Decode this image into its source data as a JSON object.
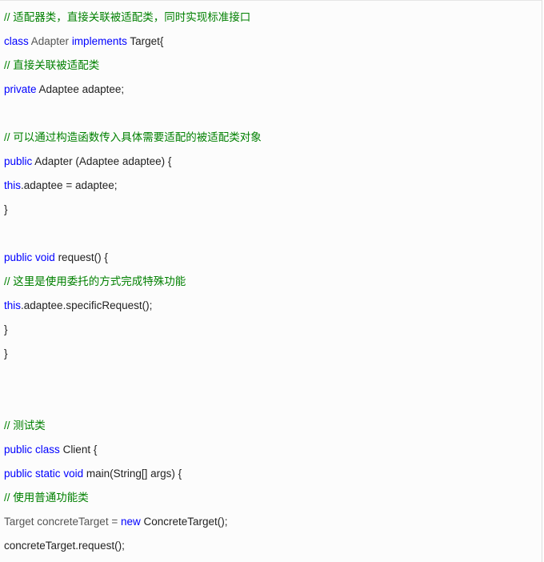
{
  "colors": {
    "comment": "#008000",
    "keyword": "#0000ff",
    "text": "#222222",
    "muted_text": "#555555",
    "background": "#fcfcfc"
  },
  "code": {
    "lines": [
      [
        {
          "t": "comment",
          "v": "// 适配器类，直接关联被适配类，同时实现标准接口"
        }
      ],
      [
        {
          "t": "keyword",
          "v": "class"
        },
        {
          "t": "muted",
          "v": " Adapter "
        },
        {
          "t": "keyword",
          "v": "implements"
        },
        {
          "t": "plain",
          "v": " Target{"
        }
      ],
      [
        {
          "t": "comment",
          "v": "// 直接关联被适配类"
        }
      ],
      [
        {
          "t": "keyword",
          "v": "private"
        },
        {
          "t": "plain",
          "v": " Adaptee adaptee;"
        }
      ],
      [],
      [
        {
          "t": "comment",
          "v": "// 可以通过构造函数传入具体需要适配的被适配类对象"
        }
      ],
      [
        {
          "t": "keyword",
          "v": "public"
        },
        {
          "t": "plain",
          "v": " Adapter (Adaptee adaptee) {"
        }
      ],
      [
        {
          "t": "keyword",
          "v": "this"
        },
        {
          "t": "plain",
          "v": ".adaptee = adaptee;"
        }
      ],
      [
        {
          "t": "plain",
          "v": "}"
        }
      ],
      [],
      [
        {
          "t": "keyword",
          "v": "public"
        },
        {
          "t": "plain",
          "v": " "
        },
        {
          "t": "keyword",
          "v": "void"
        },
        {
          "t": "plain",
          "v": " request() {"
        }
      ],
      [
        {
          "t": "comment",
          "v": "// 这里是使用委托的方式完成特殊功能"
        }
      ],
      [
        {
          "t": "keyword",
          "v": "this"
        },
        {
          "t": "plain",
          "v": ".adaptee.specificRequest();"
        }
      ],
      [
        {
          "t": "plain",
          "v": "}"
        }
      ],
      [
        {
          "t": "plain",
          "v": "}"
        }
      ],
      [],
      [],
      [
        {
          "t": "comment",
          "v": "// 测试类"
        }
      ],
      [
        {
          "t": "keyword",
          "v": "public"
        },
        {
          "t": "plain",
          "v": " "
        },
        {
          "t": "keyword",
          "v": "class"
        },
        {
          "t": "plain",
          "v": " Client {"
        }
      ],
      [
        {
          "t": "keyword",
          "v": "public"
        },
        {
          "t": "plain",
          "v": " "
        },
        {
          "t": "keyword",
          "v": "static"
        },
        {
          "t": "plain",
          "v": " "
        },
        {
          "t": "keyword",
          "v": "void"
        },
        {
          "t": "plain",
          "v": " main(String[] args) {"
        }
      ],
      [
        {
          "t": "comment",
          "v": "// 使用普通功能类"
        }
      ],
      [
        {
          "t": "muted",
          "v": "Target concreteTarget = "
        },
        {
          "t": "keyword",
          "v": "new"
        },
        {
          "t": "plain",
          "v": " ConcreteTarget();"
        }
      ],
      [
        {
          "t": "plain",
          "v": "concreteTarget.request();"
        }
      ]
    ]
  }
}
